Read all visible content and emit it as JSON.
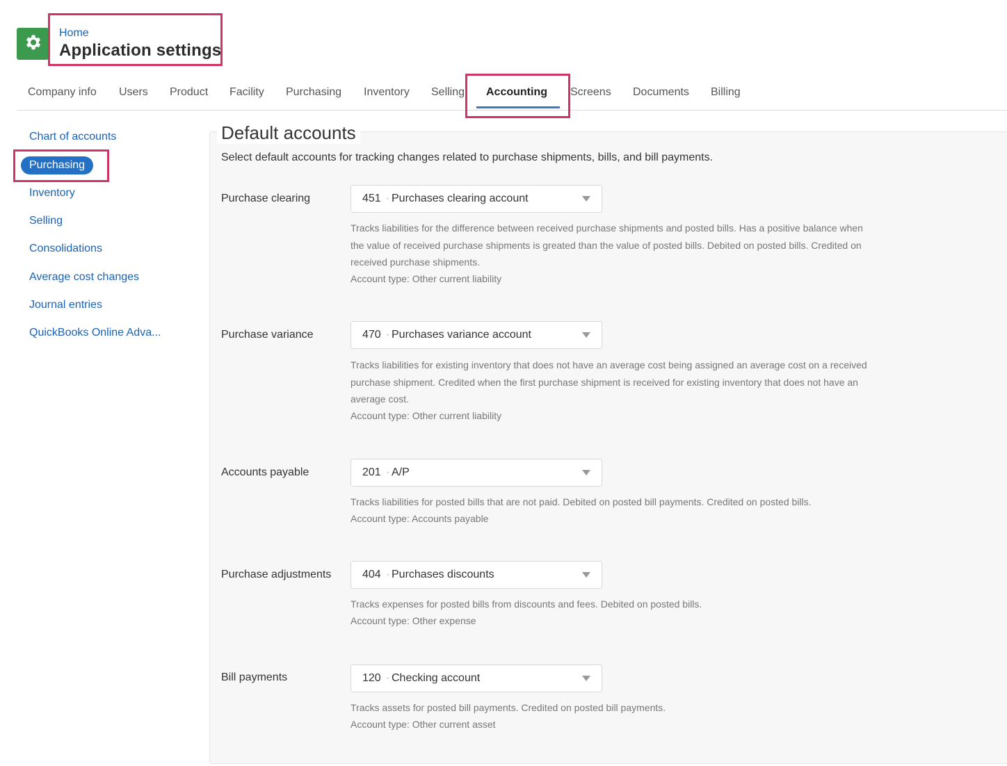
{
  "header": {
    "breadcrumb": "Home",
    "title": "Application settings",
    "app_icon": "gear-icon",
    "brand_color": "#3c9a4f",
    "highlight_color": "#d03464"
  },
  "tabs": [
    {
      "label": "Company info"
    },
    {
      "label": "Users"
    },
    {
      "label": "Product"
    },
    {
      "label": "Facility"
    },
    {
      "label": "Purchasing"
    },
    {
      "label": "Inventory"
    },
    {
      "label": "Selling"
    },
    {
      "label": "Accounting",
      "active": true
    },
    {
      "label": "Screens"
    },
    {
      "label": "Documents"
    },
    {
      "label": "Billing"
    }
  ],
  "sidebar": {
    "items": [
      {
        "label": "Chart of accounts"
      },
      {
        "label": "Purchasing",
        "active": true
      },
      {
        "label": "Inventory"
      },
      {
        "label": "Selling"
      },
      {
        "label": "Consolidations"
      },
      {
        "label": "Average cost changes"
      },
      {
        "label": "Journal entries"
      },
      {
        "label": "QuickBooks Online Adva..."
      }
    ]
  },
  "main": {
    "title": "Default accounts",
    "description": "Select default accounts for tracking changes related to purchase shipments, bills, and bill payments.",
    "rows": [
      {
        "label": "Purchase clearing",
        "account_number": "451",
        "account_name": "Purchases clearing account",
        "help": "Tracks liabilities for the difference between received purchase shipments and posted bills. Has a positive balance when the value of received purchase shipments is greated than the value of posted bills. Debited on posted bills. Credited on received purchase shipments.",
        "account_type": "Account type: Other current liability"
      },
      {
        "label": "Purchase variance",
        "account_number": "470",
        "account_name": "Purchases variance account",
        "help": "Tracks liabilities for existing inventory that does not have an average cost being assigned an average cost on a received purchase shipment. Credited when the first purchase shipment is received for existing inventory that does not have an average cost.",
        "account_type": "Account type: Other current liability"
      },
      {
        "label": "Accounts payable",
        "account_number": "201",
        "account_name": "A/P",
        "help": "Tracks liabilities for posted bills that are not paid. Debited on posted bill payments. Credited on posted bills.",
        "account_type": "Account type: Accounts payable"
      },
      {
        "label": "Purchase adjustments",
        "account_number": "404",
        "account_name": "Purchases discounts",
        "help": "Tracks expenses for posted bills from discounts and fees. Debited on posted bills.",
        "account_type": "Account type: Other expense"
      },
      {
        "label": "Bill payments",
        "account_number": "120",
        "account_name": "Checking account",
        "help": "Tracks assets for posted bill payments. Credited on posted bill payments.",
        "account_type": "Account type: Other current asset"
      }
    ]
  }
}
